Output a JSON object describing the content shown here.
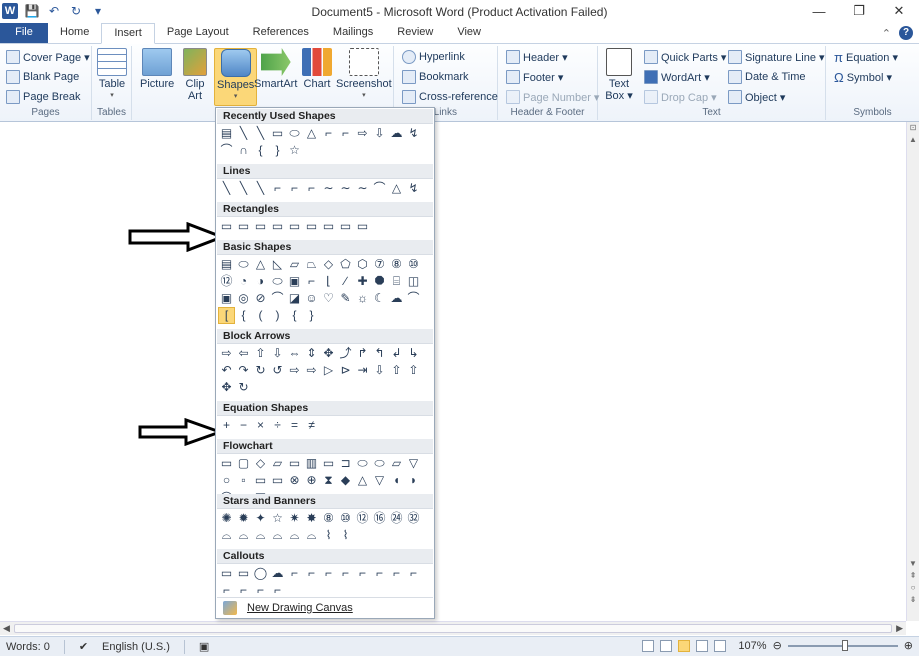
{
  "window": {
    "title": "Document5 - Microsoft Word (Product Activation Failed)",
    "minimize": "—",
    "maximize": "❐",
    "close": "✕"
  },
  "qat": {
    "logo": "W",
    "save": "💾",
    "undo": "↶",
    "redo": "↻",
    "customize": "▾"
  },
  "tabs": [
    "File",
    "Home",
    "Insert",
    "Page Layout",
    "References",
    "Mailings",
    "Review",
    "View"
  ],
  "active_tab": "Insert",
  "ribbon": {
    "pages": {
      "label": "Pages",
      "cover_page": "Cover Page ▾",
      "blank_page": "Blank Page",
      "page_break": "Page Break"
    },
    "tables": {
      "label": "Tables",
      "table": "Table"
    },
    "illustrations": {
      "picture": "Picture",
      "clip_art": "Clip Art",
      "shapes": "Shapes",
      "smartart": "SmartArt",
      "chart": "Chart",
      "screenshot": "Screenshot"
    },
    "links": {
      "label": "Links",
      "hyperlink": "Hyperlink",
      "bookmark": "Bookmark",
      "cross_reference": "Cross-reference"
    },
    "header_footer": {
      "label": "Header & Footer",
      "header": "Header ▾",
      "footer": "Footer ▾",
      "page_number": "Page Number ▾"
    },
    "text": {
      "label": "Text",
      "text_box": "Text Box ▾",
      "quick_parts": "Quick Parts ▾",
      "wordart": "WordArt ▾",
      "drop_cap": "Drop Cap ▾",
      "signature_line": "Signature Line ▾",
      "date_time": "Date & Time",
      "object": "Object ▾"
    },
    "symbols": {
      "label": "Symbols",
      "equation": "Equation ▾",
      "symbol": "Symbol ▾"
    }
  },
  "shapes_menu": {
    "sections": [
      {
        "title": "Recently Used Shapes",
        "glyphs": [
          "▤",
          "╲",
          "╲",
          "▭",
          "⬭",
          "△",
          "⌐",
          "⌐",
          "⇨",
          "⇩",
          "☁",
          "↯",
          "⌒",
          "∩",
          "{",
          "}",
          "☆"
        ]
      },
      {
        "title": "Lines",
        "glyphs": [
          "╲",
          "╲",
          "╲",
          "⌐",
          "⌐",
          "⌐",
          "∼",
          "∼",
          "∼",
          "⌒",
          "△",
          "↯"
        ]
      },
      {
        "title": "Rectangles",
        "glyphs": [
          "▭",
          "▭",
          "▭",
          "▭",
          "▭",
          "▭",
          "▭",
          "▭",
          "▭"
        ]
      },
      {
        "title": "Basic Shapes",
        "glyphs": [
          "▤",
          "⬭",
          "△",
          "◺",
          "▱",
          "⏢",
          "◇",
          "⬠",
          "⬡",
          "⑦",
          "⑧",
          "⑩",
          "⑫",
          "◔",
          "◑",
          "⬭",
          "▣",
          "⌐",
          "⌊",
          "∕",
          "✚",
          "⯃",
          "⌸",
          "◫",
          "▣",
          "◎",
          "⊘",
          "⌒",
          "◪",
          "☺",
          "♡",
          "✎",
          "☼",
          "☾",
          "☁",
          "⌒",
          "[",
          "{",
          "(",
          ")",
          "{",
          "}"
        ]
      },
      {
        "title": "Block Arrows",
        "glyphs": [
          "⇨",
          "⇦",
          "⇧",
          "⇩",
          "⇔",
          "⇕",
          "✥",
          "⤴",
          "↱",
          "↰",
          "↲",
          "↳",
          "↶",
          "↷",
          "↻",
          "↺",
          "⇨",
          "⇨",
          "▷",
          "⊳",
          "⇥",
          "⇩",
          "⇧",
          "⇧",
          "✥",
          "↻"
        ]
      },
      {
        "title": "Equation Shapes",
        "glyphs": [
          "+",
          "−",
          "×",
          "÷",
          "=",
          "≠"
        ]
      },
      {
        "title": "Flowchart",
        "glyphs": [
          "▭",
          "▢",
          "◇",
          "▱",
          "▭",
          "▥",
          "▭",
          "⊐",
          "⬭",
          "⬭",
          "▱",
          "▽",
          "○",
          "▫",
          "▭",
          "▭",
          "⊗",
          "⊕",
          "⧗",
          "◆",
          "△",
          "▽",
          "◖",
          "◗",
          "◯",
          "▭",
          "◫",
          "⬭"
        ]
      },
      {
        "title": "Stars and Banners",
        "glyphs": [
          "✺",
          "✹",
          "✦",
          "☆",
          "✷",
          "✸",
          "⑧",
          "⑩",
          "⑫",
          "⑯",
          "㉔",
          "㉜",
          "⌓",
          "⌓",
          "⌓",
          "⌓",
          "⌓",
          "⌓",
          "⌇",
          "⌇"
        ]
      },
      {
        "title": "Callouts",
        "glyphs": [
          "▭",
          "▭",
          "◯",
          "☁",
          "⌐",
          "⌐",
          "⌐",
          "⌐",
          "⌐",
          "⌐",
          "⌐",
          "⌐",
          "⌐",
          "⌐",
          "⌐",
          "⌐"
        ]
      }
    ],
    "selected_section": 3,
    "selected_index": 36,
    "new_canvas": "New Drawing Canvas"
  },
  "status": {
    "words": "Words: 0",
    "language": "English (U.S.)",
    "zoom": "107%",
    "zoom_fraction": 0.52
  },
  "colors": {
    "accent": "#2b579a",
    "highlight": "#fbd778"
  }
}
